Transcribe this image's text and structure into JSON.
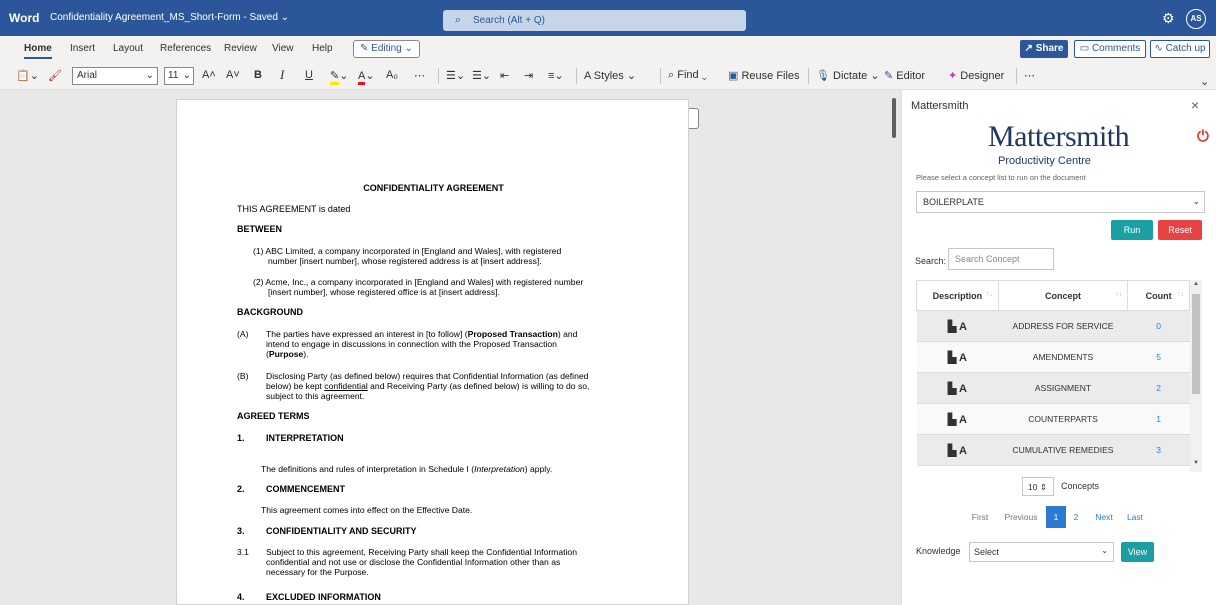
{
  "titlebar": {
    "app": "Word",
    "doc_title": "Confidentiality Agreement_MS_Short-Form  -  Saved ⌄",
    "search_placeholder": "Search (Alt + Q)",
    "avatar": "AS"
  },
  "menu": {
    "tabs": [
      "Home",
      "Insert",
      "Layout",
      "References",
      "Review",
      "View",
      "Help"
    ],
    "editing": "Editing ⌄",
    "share": "Share",
    "comments": "Comments",
    "catchup": "Catch up"
  },
  "toolbar": {
    "font": "Arial",
    "size": "11",
    "styles": "Styles",
    "find": "Find",
    "reuse": "Reuse Files",
    "dictate": "Dictate",
    "editor": "Editor",
    "designer": "Designer"
  },
  "doc": {
    "title": "CONFIDENTIALITY AGREEMENT",
    "dated": "THIS AGREEMENT is dated",
    "between": "BETWEEN",
    "party1_a": "(1) ABC Limited, a company incorporated in [England and Wales], with registered",
    "party1_b": "number [insert number], whose registered address is at [insert address].",
    "party2_a": "(2) Acme, Inc., a company incorporated in [England and Wales] with registered number",
    "party2_b": "[insert number], whose registered office is at [insert address].",
    "background": "BACKGROUND",
    "a_label": "(A)",
    "a_l1_pre": "The parties have expressed an interest in [to follow] (",
    "a_l1_bold": "Proposed Transaction",
    "a_l1_post": ") and",
    "a_l2": "intend to engage in discussions in connection with the Proposed Transaction",
    "a_l3_pre": "(",
    "a_l3_bold": "Purpose",
    "a_l3_post": ").",
    "b_label": "(B)",
    "b_l1": "Disclosing Party (as defined below) requires that Confidential Information (as defined",
    "b_l2_pre": "below) be kept ",
    "b_l2_u": "confidential",
    "b_l2_post": " and Receiving Party (as defined below) is willing to do so,",
    "b_l3": "subject to this agreement.",
    "agreed": "AGREED TERMS",
    "s1_num": "1.",
    "s1": "INTERPRETATION",
    "s1_text_pre": "The definitions and rules of interpretation in Schedule I (",
    "s1_text_i": "Interpretation",
    "s1_text_post": ") apply.",
    "s2_num": "2.",
    "s2": "COMMENCEMENT",
    "s2_text": "This agreement comes into effect on the Effective Date.",
    "s3_num": "3.",
    "s3": "CONFIDENTIALITY AND SECURITY",
    "s31_num": "3.1",
    "s31_l1": "Subject to this agreement, Receiving Party shall keep the Confidential Information",
    "s31_l2": "confidential and not use or disclose the Confidential Information other than as",
    "s31_l3": "necessary for the Purpose.",
    "s4_num": "4.",
    "s4": "EXCLUDED INFORMATION"
  },
  "pane": {
    "header": "Mattersmith",
    "brand": "Mattersmith",
    "brand_sub": "Productivity Centre",
    "instruction": "Please select a concept list to run on the document",
    "concept_list": "BOILERPLATE",
    "run": "Run",
    "reset": "Reset",
    "search_label": "Search:",
    "search_placeholder": "Search Concept",
    "columns": [
      "Description",
      "Concept",
      "Count"
    ],
    "rows": [
      {
        "concept": "ADDRESS FOR SERVICE",
        "count": "0"
      },
      {
        "concept": "AMENDMENTS",
        "count": "5"
      },
      {
        "concept": "ASSIGNMENT",
        "count": "2"
      },
      {
        "concept": "COUNTERPARTS",
        "count": "1"
      },
      {
        "concept": "CUMULATIVE REMEDIES",
        "count": "3"
      }
    ],
    "desc_glyph": "A",
    "page_size": "10",
    "concepts_label": "Concepts",
    "pager": [
      "First",
      "Previous",
      "1",
      "2",
      "Next",
      "Last"
    ],
    "knowledge_label": "Knowledge",
    "knowledge_select": "Select",
    "view": "View"
  },
  "colors": {
    "word_blue": "#2b579a",
    "teal": "#1a9fa5",
    "red": "#e84343",
    "brand_navy": "#1f3864"
  }
}
